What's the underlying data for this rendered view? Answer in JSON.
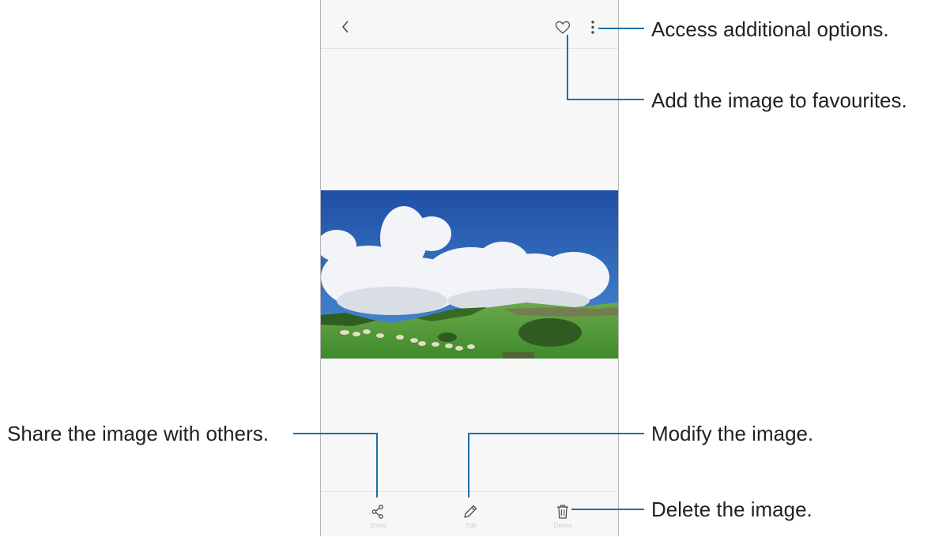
{
  "callouts": {
    "more_options": "Access additional options.",
    "favourite": "Add the image to favourites.",
    "share": "Share the image with others.",
    "edit": "Modify the image.",
    "delete": "Delete the image."
  },
  "toolbar": {
    "share_label": "Share",
    "edit_label": "Edit",
    "delete_label": "Delete"
  },
  "icons": {
    "back": "back-chevron-icon",
    "favourite": "heart-outline-icon",
    "more": "more-vertical-icon",
    "share": "share-icon",
    "edit": "pencil-icon",
    "delete": "trash-icon"
  },
  "colors": {
    "callout_line": "#1f6fa8",
    "sky": "#2d63b8",
    "grass": "#4f9a34"
  }
}
